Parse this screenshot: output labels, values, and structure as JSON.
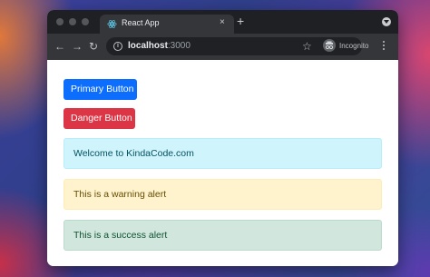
{
  "browser": {
    "tab": {
      "title": "React App",
      "favicon": "react-icon",
      "close_label": "×"
    },
    "new_tab_label": "+",
    "toolbar": {
      "back_label": "←",
      "forward_label": "→",
      "reload_label": "↻",
      "url_host": "localhost",
      "url_port": ":3000",
      "info_label": "i",
      "star_label": "☆",
      "incognito_label": "Incognito"
    }
  },
  "page": {
    "buttons": {
      "primary_label": "Primary Button",
      "danger_label": "Danger Button"
    },
    "alerts": {
      "info_text": "Welcome to KindaCode.com",
      "warning_text": "This is a warning alert",
      "success_text": "This is a success alert"
    }
  },
  "colors": {
    "primary": "#0d6efd",
    "danger": "#dc3545",
    "info_bg": "#cff4fc",
    "warning_bg": "#fff3cd",
    "success_bg": "#d1e7dd"
  }
}
